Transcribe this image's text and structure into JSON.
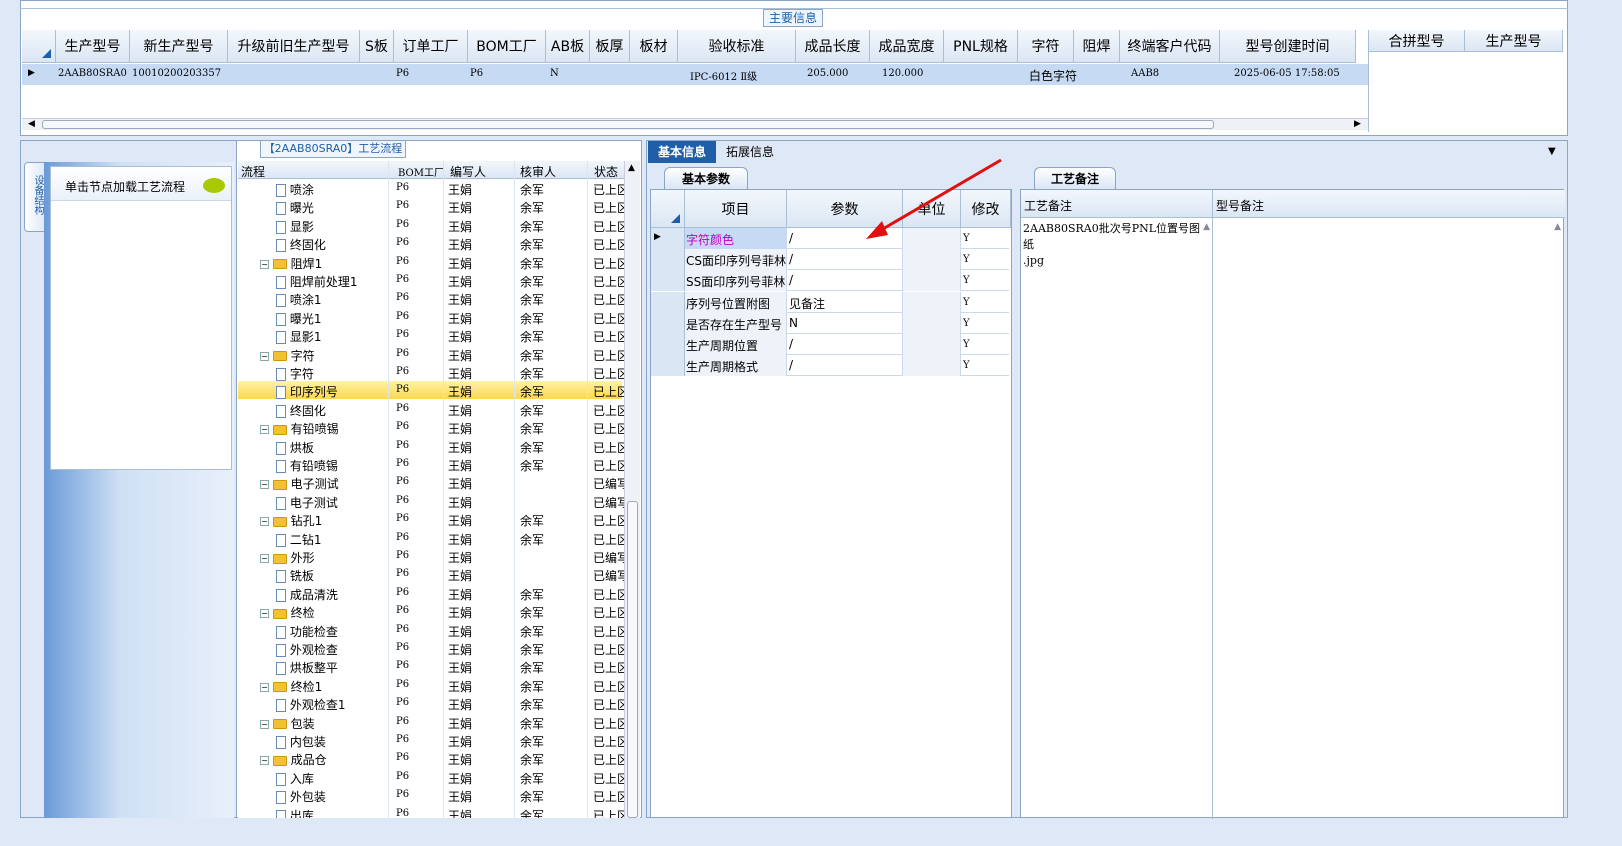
{
  "top": {
    "group_title": "主要信息",
    "columns": [
      "生产型号",
      "新生产型号",
      "升级前旧生产型号",
      "S板",
      "订单工厂",
      "BOM工厂",
      "AB板",
      "板厚",
      "板材",
      "验收标准",
      "成品长度",
      "成品宽度",
      "PNL规格",
      "字符",
      "阻焊",
      "终端客户代码",
      "型号创建时间"
    ],
    "row": {
      "col1": "2AAB80SRA0",
      "col2": "10010200203357",
      "col5": "P6",
      "col6": "P6",
      "col7": "N",
      "col10": "IPC-6012 Ⅱ级",
      "col11": "205.000",
      "col12": "120.000",
      "col14": "白色字符",
      "col16": "AAB8",
      "col17": "2025-06-05 17:58:05"
    },
    "right_columns": [
      "合拼型号",
      "生产型号"
    ]
  },
  "left_panel": {
    "vertical_tab": "设备结构",
    "hint": "单击节点加载工艺流程"
  },
  "flow": {
    "title": "【2AAB80SRA0】工艺流程",
    "columns": [
      "流程",
      "BOM工厂",
      "编写人",
      "核审人",
      "状态"
    ],
    "rows": [
      {
        "name": "喷涂",
        "f": "P6",
        "w": "王娟",
        "r": "余军",
        "s": "已上区"
      },
      {
        "name": "曝光",
        "f": "P6",
        "w": "王娟",
        "r": "余军",
        "s": "已上区"
      },
      {
        "name": "显影",
        "f": "P6",
        "w": "王娟",
        "r": "余军",
        "s": "已上区"
      },
      {
        "name": "终固化",
        "f": "P6",
        "w": "王娟",
        "r": "余军",
        "s": "已上区"
      },
      {
        "name": "阻焊1",
        "f": "P6",
        "w": "王娟",
        "r": "余军",
        "s": "已上区",
        "folder": true
      },
      {
        "name": "阻焊前处理1",
        "f": "P6",
        "w": "王娟",
        "r": "余军",
        "s": "已上区"
      },
      {
        "name": "喷涂1",
        "f": "P6",
        "w": "王娟",
        "r": "余军",
        "s": "已上区"
      },
      {
        "name": "曝光1",
        "f": "P6",
        "w": "王娟",
        "r": "余军",
        "s": "已上区"
      },
      {
        "name": "显影1",
        "f": "P6",
        "w": "王娟",
        "r": "余军",
        "s": "已上区"
      },
      {
        "name": "字符",
        "f": "P6",
        "w": "王娟",
        "r": "余军",
        "s": "已上区",
        "folder": true
      },
      {
        "name": "字符",
        "f": "P6",
        "w": "王娟",
        "r": "余军",
        "s": "已上区"
      },
      {
        "name": "印序列号",
        "f": "P6",
        "w": "王娟",
        "r": "余军",
        "s": "已上区",
        "sel": true
      },
      {
        "name": "终固化",
        "f": "P6",
        "w": "王娟",
        "r": "余军",
        "s": "已上区"
      },
      {
        "name": "有铅喷锡",
        "f": "P6",
        "w": "王娟",
        "r": "余军",
        "s": "已上区",
        "folder": true
      },
      {
        "name": "烘板",
        "f": "P6",
        "w": "王娟",
        "r": "余军",
        "s": "已上区"
      },
      {
        "name": "有铅喷锡",
        "f": "P6",
        "w": "王娟",
        "r": "余军",
        "s": "已上区"
      },
      {
        "name": "电子测试",
        "f": "P6",
        "w": "王娟",
        "r": "",
        "s": "已编写",
        "folder": true
      },
      {
        "name": "电子测试",
        "f": "P6",
        "w": "王娟",
        "r": "",
        "s": "已编写"
      },
      {
        "name": "钻孔1",
        "f": "P6",
        "w": "王娟",
        "r": "余军",
        "s": "已上区",
        "folder": true
      },
      {
        "name": "二钻1",
        "f": "P6",
        "w": "王娟",
        "r": "余军",
        "s": "已上区"
      },
      {
        "name": "外形",
        "f": "P6",
        "w": "王娟",
        "r": "",
        "s": "已编写",
        "folder": true
      },
      {
        "name": "铣板",
        "f": "P6",
        "w": "王娟",
        "r": "",
        "s": "已编写"
      },
      {
        "name": "成品清洗",
        "f": "P6",
        "w": "王娟",
        "r": "余军",
        "s": "已上区"
      },
      {
        "name": "终检",
        "f": "P6",
        "w": "王娟",
        "r": "余军",
        "s": "已上区",
        "folder": true
      },
      {
        "name": "功能检查",
        "f": "P6",
        "w": "王娟",
        "r": "余军",
        "s": "已上区"
      },
      {
        "name": "外观检查",
        "f": "P6",
        "w": "王娟",
        "r": "余军",
        "s": "已上区"
      },
      {
        "name": "烘板整平",
        "f": "P6",
        "w": "王娟",
        "r": "余军",
        "s": "已上区"
      },
      {
        "name": "终检1",
        "f": "P6",
        "w": "王娟",
        "r": "余军",
        "s": "已上区",
        "folder": true
      },
      {
        "name": "外观检查1",
        "f": "P6",
        "w": "王娟",
        "r": "余军",
        "s": "已上区"
      },
      {
        "name": "包装",
        "f": "P6",
        "w": "王娟",
        "r": "余军",
        "s": "已上区",
        "folder": true
      },
      {
        "name": "内包装",
        "f": "P6",
        "w": "王娟",
        "r": "余军",
        "s": "已上区"
      },
      {
        "name": "成品仓",
        "f": "P6",
        "w": "王娟",
        "r": "余军",
        "s": "已上区",
        "folder": true
      },
      {
        "name": "入库",
        "f": "P6",
        "w": "王娟",
        "r": "余军",
        "s": "已上区"
      },
      {
        "name": "外包装",
        "f": "P6",
        "w": "王娟",
        "r": "余军",
        "s": "已上区"
      },
      {
        "name": "出库",
        "f": "P6",
        "w": "王娟",
        "r": "余军",
        "s": "已上区"
      }
    ]
  },
  "info": {
    "tabs": [
      "基本信息",
      "拓展信息"
    ],
    "sub_tab": "基本参数",
    "columns": [
      "项目",
      "参数",
      "单位",
      "修改"
    ],
    "rows": [
      {
        "item": "字符颜色",
        "param": "/",
        "unit": "",
        "mod": "Y"
      },
      {
        "item": "CS面印序列号菲林",
        "param": "/",
        "unit": "",
        "mod": "Y"
      },
      {
        "item": "SS面印序列号菲林",
        "param": "/",
        "unit": "",
        "mod": "Y"
      },
      {
        "item": "序列号位置附图",
        "param": "见备注",
        "unit": "",
        "mod": "Y"
      },
      {
        "item": "是否存在生产型号",
        "param": "N",
        "unit": "",
        "mod": "Y"
      },
      {
        "item": "生产周期位置",
        "param": "/",
        "unit": "",
        "mod": "Y"
      },
      {
        "item": "生产周期格式",
        "param": "/",
        "unit": "",
        "mod": "Y"
      }
    ]
  },
  "remarks": {
    "tab": "工艺备注",
    "col1": "工艺备注",
    "col2": "型号备注",
    "text1": "2AAB80SRA0批次号PNL位置号图纸",
    "text2": ".jpg"
  },
  "colors": {
    "accent": "#1f5fa8",
    "annotation_arrow": "#e01010",
    "selected_row": "#ffd84a",
    "highlight_text": "#c000c0"
  }
}
